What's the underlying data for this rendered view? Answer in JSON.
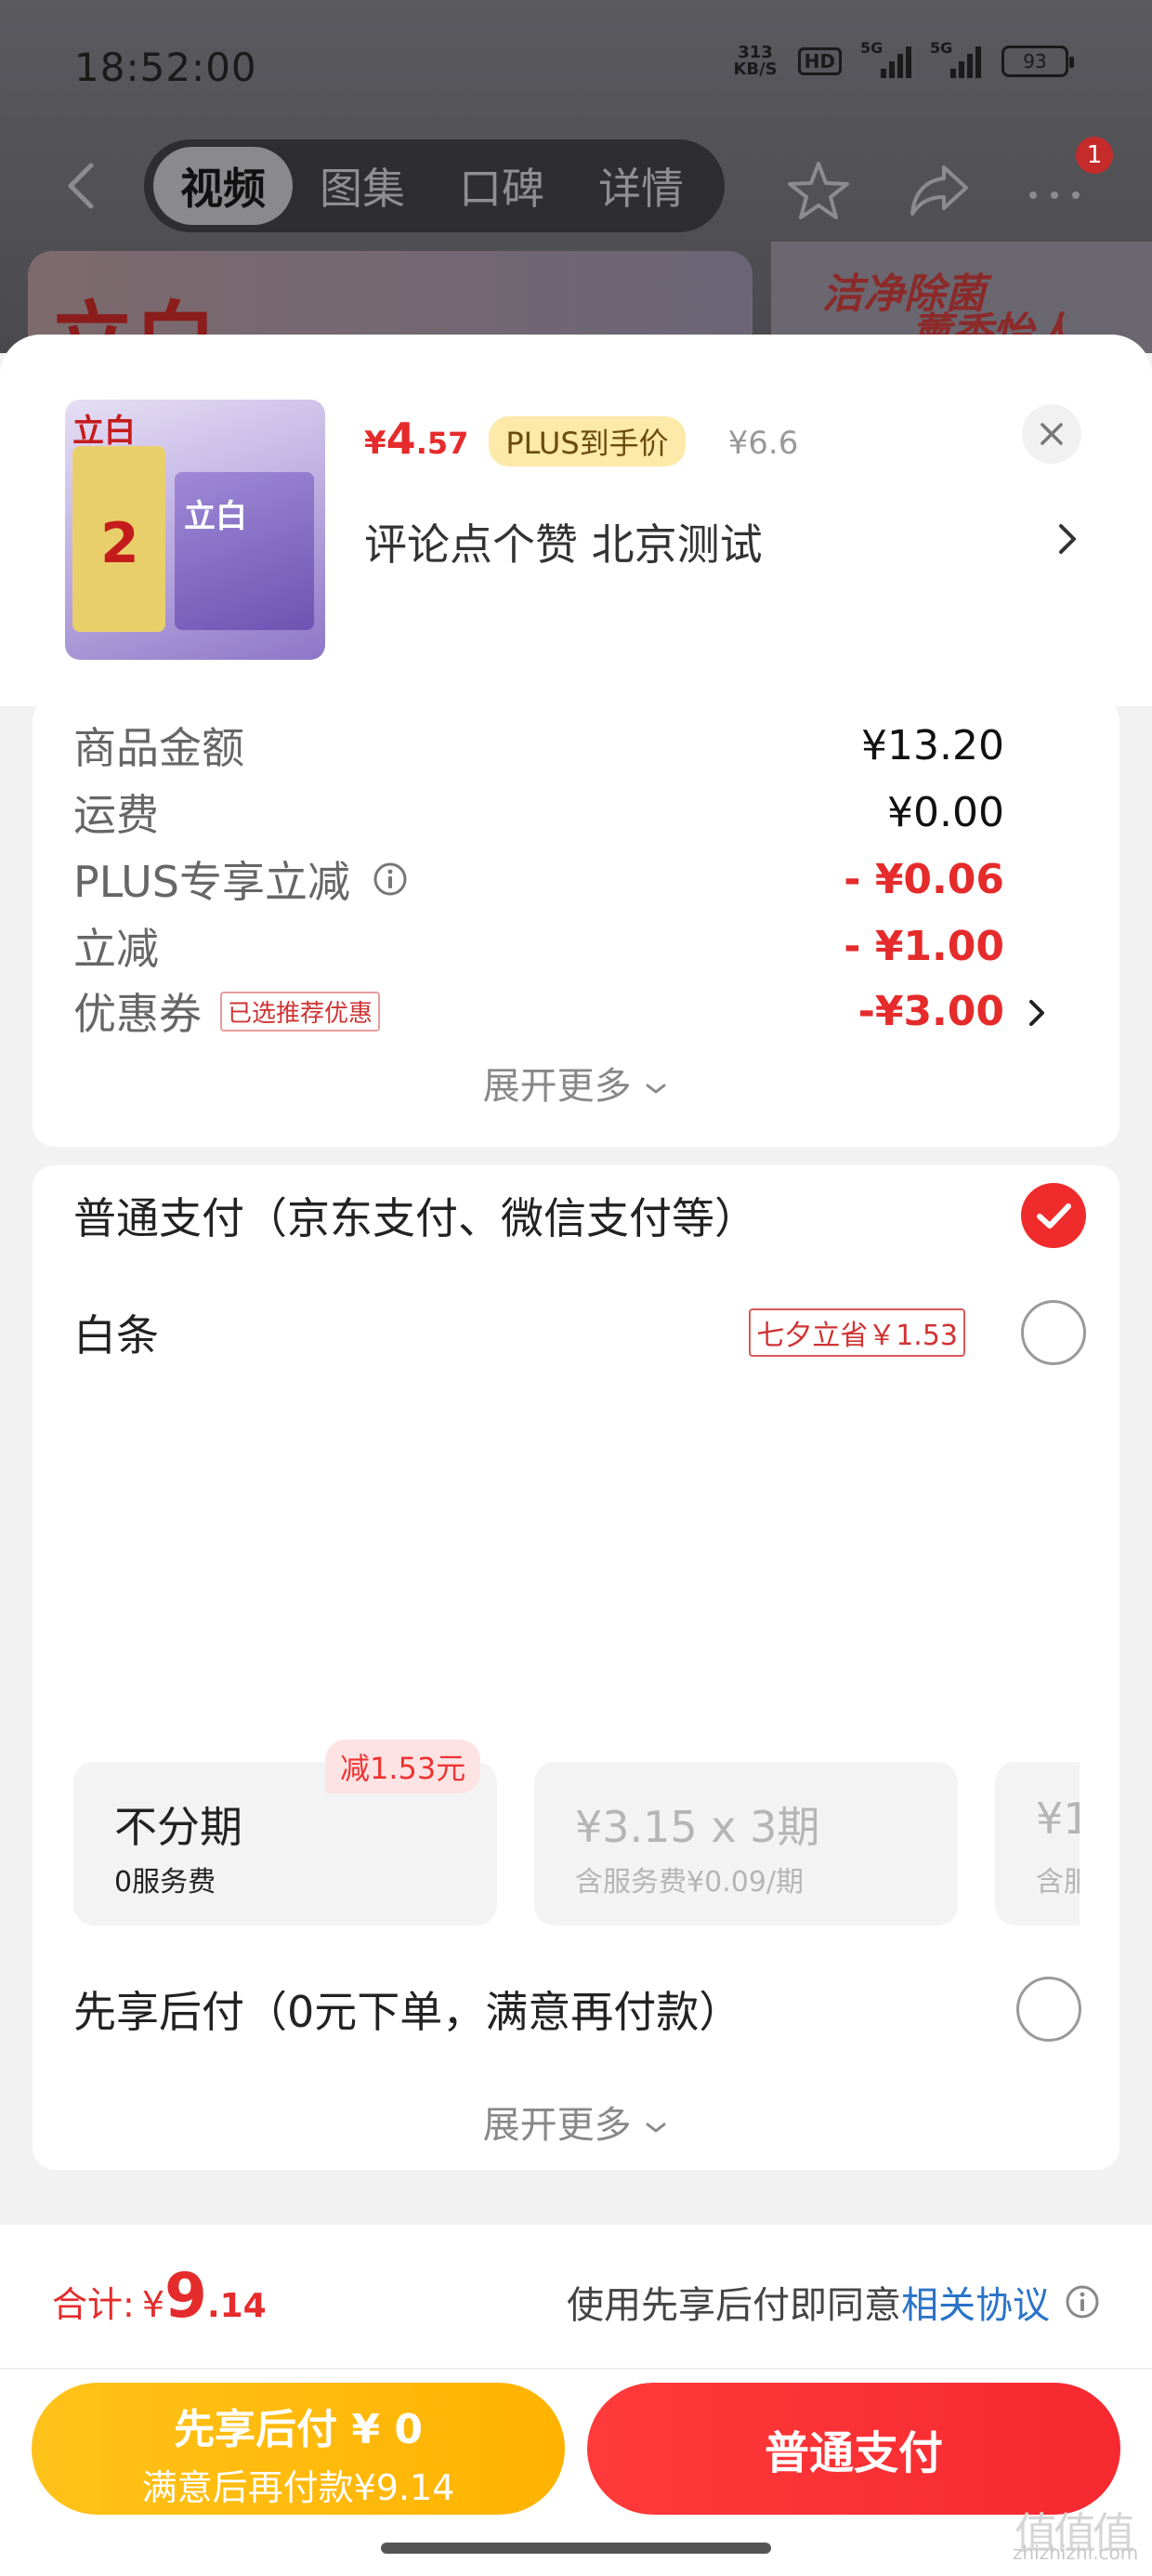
{
  "status_bar": {
    "time": "18:52:00",
    "net_speed_value": "313",
    "net_speed_unit": "KB/S",
    "hd_label": "HD",
    "signal1_label": "5G",
    "signal2_label": "5G",
    "battery": "93"
  },
  "nav": {
    "tabs": [
      "视频",
      "图集",
      "口碑",
      "详情"
    ],
    "active_tab": "视频",
    "notification_count": "1"
  },
  "banner": {
    "brand": "立白",
    "slogan1": "洁净除菌",
    "slogan2": "薰香怡人"
  },
  "product": {
    "image_brand": "立白",
    "image_count": "2",
    "image_box_brand": "立白",
    "price_symbol": "¥",
    "price_int": "4",
    "price_dec": ".57",
    "plus_label": "PLUS到手价",
    "original_price": "¥6.6",
    "spec": "评论点个赞  北京测试"
  },
  "amounts": {
    "rows": [
      {
        "label": "商品金额",
        "value": "¥13.20"
      },
      {
        "label": "运费",
        "value": "¥0.00"
      },
      {
        "label": "PLUS专享立减",
        "value": "- ¥0.06"
      },
      {
        "label": "立减",
        "value": "- ¥1.00"
      },
      {
        "label": "优惠券",
        "tag": "已选推荐优惠",
        "value": "-¥3.00"
      }
    ],
    "expand_label": "展开更多"
  },
  "payment": {
    "normal_label": "普通支付（京东支付、微信支付等）",
    "baitiao_label": "白条",
    "baitiao_promo": "七夕立省￥1.53",
    "reduce_badge": "减1.53元",
    "installments": [
      {
        "title": "不分期",
        "sub": "0服务费"
      },
      {
        "title": "¥3.15 x 3期",
        "sub": "含服务费¥0.09/期"
      },
      {
        "title": "¥1",
        "sub": "含服"
      }
    ],
    "later_label": "先享后付（0元下单，满意再付款）",
    "expand_label": "展开更多"
  },
  "footer": {
    "total_label": "合计:",
    "total_symbol": "¥",
    "total_int": "9",
    "total_dec": ".14",
    "agree_prefix": "使用先享后付即同意",
    "agree_link": "相关协议",
    "btn_later_line1": "先享后付 ¥ 0",
    "btn_later_line2": "满意后再付款¥9.14",
    "btn_normal": "普通支付"
  },
  "watermark": {
    "url": "zhizhizhi.com",
    "logo": "值值值"
  },
  "colors": {
    "accent_red": "#e52b2b",
    "plus_gold": "#fde9a9",
    "link_blue": "#2a73c9",
    "yellow_button": "#ffb300"
  }
}
